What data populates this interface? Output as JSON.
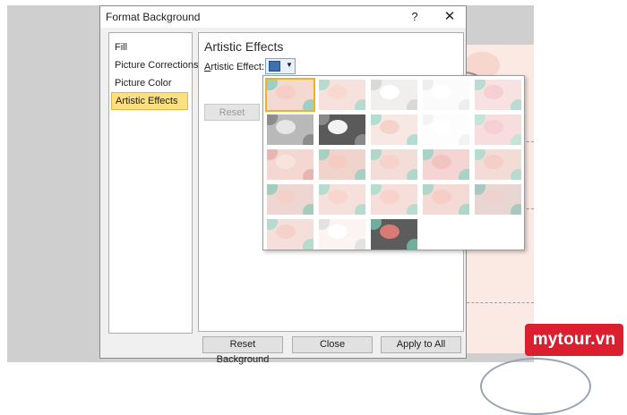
{
  "dialog": {
    "title": "Format Background",
    "help_label": "?",
    "close_label": "✕"
  },
  "nav": {
    "items": [
      {
        "label": "Fill"
      },
      {
        "label": "Picture Corrections"
      },
      {
        "label": "Picture Color"
      },
      {
        "label": "Artistic Effects",
        "selected": true
      }
    ]
  },
  "content": {
    "heading": "Artistic Effects",
    "effect_label_accel": "A",
    "effect_label_rest": "rtistic Effect:",
    "reset_label": "Reset",
    "caret": "▼"
  },
  "footer": {
    "reset_background": "Reset Background",
    "close": "Close",
    "apply_all": "Apply to All"
  },
  "gallery": {
    "tiles": [
      {
        "bg": "#f3d9d2",
        "c": "#9fcfc1",
        "blob": "#f7cec6",
        "selected": true
      },
      {
        "bg": "#f6e1dc",
        "c": "#b6dcd1",
        "blob": "#f8d9d2"
      },
      {
        "bg": "#f1eeee",
        "c": "#d9d9d9",
        "blob": "#ffffff"
      },
      {
        "bg": "#fbfbfb",
        "c": "#eeeeee",
        "blob": "#ffffff"
      },
      {
        "bg": "#f7e1e1",
        "c": "#b9ddd2",
        "blob": "#f5cfd2"
      },
      {
        "bg": "#b9b9b9",
        "c": "#8c8c8c",
        "blob": "#e6e6e6"
      },
      {
        "bg": "#5a5a5a",
        "c": "#8a8a8a",
        "blob": "#f2f2f2"
      },
      {
        "bg": "#f7e8e4",
        "c": "#b3ddd0",
        "blob": "#f4d3cb"
      },
      {
        "bg": "#fdfdfd",
        "c": "#f3f3f3",
        "blob": "#ffffff"
      },
      {
        "bg": "#f7dddd",
        "c": "#c5e4d9",
        "blob": "#f4d0d3"
      },
      {
        "bg": "#f5d7d2",
        "c": "#e8b6b0",
        "blob": "#f8e3df"
      },
      {
        "bg": "#f0d3cd",
        "c": "#a9cfc3",
        "blob": "#f5cbc2"
      },
      {
        "bg": "#f3ddd8",
        "c": "#b3d6cb",
        "blob": "#f6d2ca"
      },
      {
        "bg": "#f4d5d3",
        "c": "#a7d4c6",
        "blob": "#f2c4c0"
      },
      {
        "bg": "#f3dcd6",
        "c": "#b5dccf",
        "blob": "#f5cfc7"
      },
      {
        "bg": "#eed7d2",
        "c": "#a4ccbf",
        "blob": "#f3d0c8"
      },
      {
        "bg": "#f5e0dc",
        "c": "#b7dbcf",
        "blob": "#f8d6ce"
      },
      {
        "bg": "#f6dfda",
        "c": "#b8ddd0",
        "blob": "#f7d3cb"
      },
      {
        "bg": "#f4dad5",
        "c": "#aed7ca",
        "blob": "#f6cec6"
      },
      {
        "bg": "#e8d6d2",
        "c": "#a9c8bf",
        "blob": "#efd2cc"
      },
      {
        "bg": "#f5dfdb",
        "c": "#b5dace",
        "blob": "#f4d2ca"
      },
      {
        "bg": "#fbf4f3",
        "c": "#e2e2e2",
        "blob": "#ffffff"
      },
      {
        "bg": "#5c5c5c",
        "c": "#6fae9c",
        "blob": "#d97a77"
      }
    ]
  },
  "watermark": {
    "text": "mytour.vn"
  }
}
